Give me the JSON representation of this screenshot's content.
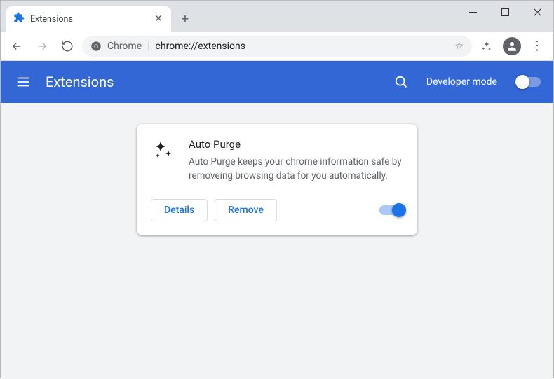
{
  "window": {
    "tab_title": "Extensions"
  },
  "omnibox": {
    "scheme": "Chrome",
    "path": "chrome://extensions"
  },
  "header": {
    "title": "Extensions",
    "developer_mode_label": "Developer mode"
  },
  "extension_card": {
    "name": "Auto Purge",
    "description": "Auto Purge keeps your chrome information safe by removeing browsing data for you automatically.",
    "details_label": "Details",
    "remove_label": "Remove",
    "enabled": true
  }
}
